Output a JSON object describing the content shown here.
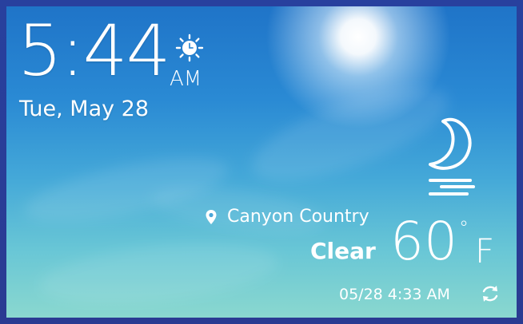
{
  "clock": {
    "time": "5:44",
    "ampm": "AM",
    "date": "Tue, May 28"
  },
  "weather": {
    "location": "Canyon Country",
    "condition": "Clear",
    "temperature": "60",
    "degree_symbol": "°",
    "unit": "F",
    "updated": "05/28 4:33 AM",
    "icon": "moon-clear-night-icon"
  },
  "icons": {
    "alarm": "sun-alarm-clock-icon",
    "location": "location-pin-icon",
    "refresh": "refresh-icon"
  },
  "colors": {
    "sky_top": "#1f74c8",
    "sky_bottom": "#8ad8cf",
    "frame": "#2b3f9a",
    "text": "#ffffff"
  }
}
